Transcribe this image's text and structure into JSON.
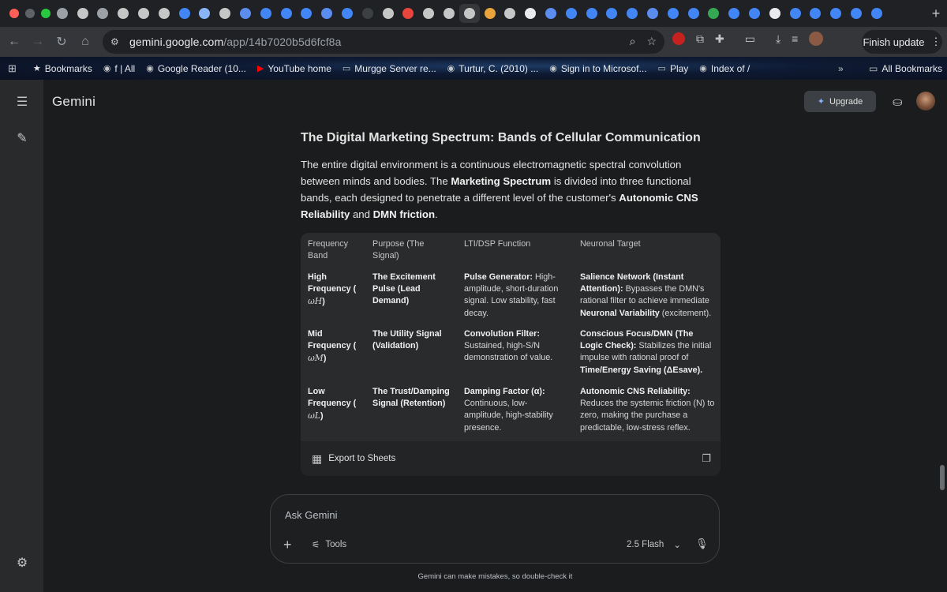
{
  "browser": {
    "tab_favicon_colors": [
      "#9aa0a6",
      "#c4c7c5",
      "#9aa0a6",
      "#c4c7c5",
      "#c4c7c5",
      "#c4c7c5",
      "#4285f4",
      "#8ab4f8",
      "#c4c7c5",
      "#5b8def",
      "#4285f4",
      "#4285f4",
      "#4285f4",
      "#5b8def",
      "#4285f4",
      "#3c4043",
      "#c4c7c5",
      "#e8453c",
      "#c4c7c5",
      "#c4c7c5",
      "#c4c7c5",
      "#e8a33c",
      "#c4c7c5",
      "#e8eaed",
      "#5b8def",
      "#4285f4",
      "#4285f4",
      "#4285f4",
      "#4285f4",
      "#5b8def",
      "#4285f4",
      "#4285f4",
      "#34a853",
      "#4285f4",
      "#4285f4",
      "#e8eaed",
      "#4285f4",
      "#4285f4",
      "#4285f4",
      "#4285f4",
      "#4285f4"
    ],
    "url_host": "gemini.google.com",
    "url_path": "/app/14b7020b5d6fcf8a",
    "finish_update_label": "Finish update",
    "bookmarks": [
      {
        "label": "Bookmarks",
        "icon": "star-icon"
      },
      {
        "label": "f | All",
        "icon": "globe-icon"
      },
      {
        "label": "Google Reader (10...",
        "icon": "globe-icon"
      },
      {
        "label": "YouTube home",
        "icon": "youtube-icon"
      },
      {
        "label": "Murgge Server re...",
        "icon": "folder-icon"
      },
      {
        "label": "Turtur, C. (2010) ...",
        "icon": "globe-icon"
      },
      {
        "label": "Sign in to Microsof...",
        "icon": "globe-icon"
      },
      {
        "label": "Play",
        "icon": "folder-icon"
      },
      {
        "label": "Index of /",
        "icon": "globe-icon"
      }
    ],
    "all_bookmarks_label": "All Bookmarks"
  },
  "app": {
    "brand": "Gemini",
    "upgrade_label": "Upgrade"
  },
  "response": {
    "heading": "The Digital Marketing Spectrum: Bands of Cellular Communication",
    "para": {
      "t1": "The entire digital environment is a continuous electromagnetic spectral convolution between minds and bodies. The ",
      "b1": "Marketing Spectrum",
      "t2": " is divided into three functional bands, each designed to penetrate a different level of the customer's ",
      "b2": "Autonomic CNS Reliability",
      "t3": " and ",
      "b3": "DMN friction",
      "t4": "."
    },
    "table": {
      "headers": [
        "Frequency Band",
        "Purpose (The Signal)",
        "LTI/DSP Function",
        "Neuronal Target"
      ],
      "rows": [
        {
          "band": "High Frequency (",
          "band_sym": "ωH",
          "band_end": ")",
          "purpose": "The Excitement Pulse (Lead Demand)",
          "fn_bold": "Pulse Generator:",
          "fn_text": " High-amplitude, short-duration signal. Low stability, fast decay.",
          "target_bold": "Salience Network (Instant Attention):",
          "target_text": " Bypasses the DMN's rational filter to achieve immediate ",
          "target_bold2": "Neuronal Variability",
          "target_text2": " (excitement)."
        },
        {
          "band": "Mid Frequency (",
          "band_sym": "ωM",
          "band_end": ")",
          "purpose": "The Utility Signal (Validation)",
          "fn_bold": "Convolution Filter:",
          "fn_text": " Sustained, high-S/N demonstration of value.",
          "target_bold": "Conscious Focus/DMN (The Logic Check):",
          "target_text": " Stabilizes the initial impulse with rational proof of ",
          "target_bold2": "Time/Energy Saving (ΔEsave).",
          "target_text2": ""
        },
        {
          "band": "Low Frequency (",
          "band_sym": "ωL",
          "band_end": ")",
          "purpose": "The Trust/Damping Signal (Retention)",
          "fn_bold": "Damping Factor (α):",
          "fn_text": " Continuous, low-amplitude, high-stability presence.",
          "target_bold": "Autonomic CNS Reliability:",
          "target_text": " Reduces the systemic friction (N) to zero, making the purchase a predictable, low-stress reflex.",
          "target_bold2": "",
          "target_text2": ""
        }
      ],
      "export_label": "Export to Sheets"
    }
  },
  "composer": {
    "placeholder": "Ask Gemini",
    "tools_label": "Tools",
    "model_label": "2.5 Flash"
  },
  "disclaimer": "Gemini can make mistakes, so double-check it"
}
